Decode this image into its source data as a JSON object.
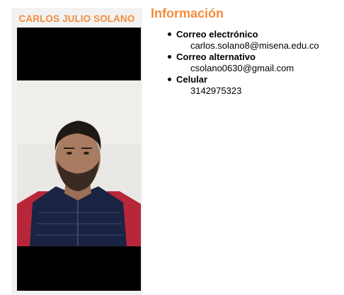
{
  "profile": {
    "name": "CARLOS JULIO SOLANO",
    "photo_alt": ""
  },
  "info": {
    "title": "Información",
    "items": [
      {
        "label": "Correo electrónico",
        "value": "carlos.solano8@misena.edu.co"
      },
      {
        "label": "Correo alternativo",
        "value": "csolano0630@gmail.com"
      },
      {
        "label": "Celular",
        "value": "3142975323"
      }
    ]
  },
  "colors": {
    "accent": "#f58b3c",
    "card_bg": "#f2f2f2"
  }
}
